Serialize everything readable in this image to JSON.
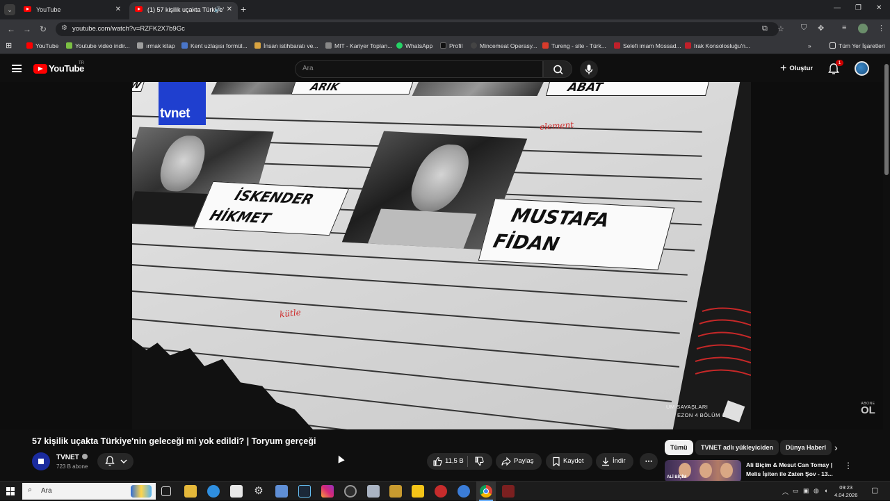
{
  "browser": {
    "tabs": [
      {
        "title": "YouTube",
        "active": false
      },
      {
        "title": "(1) 57 kişilik uçakta Türkiye'",
        "active": true
      }
    ],
    "url": "youtube.com/watch?v=RZFK2X7b9Gc",
    "bookmarks": [
      {
        "label": "YouTube",
        "color": "#ff0000"
      },
      {
        "label": "Youtube video indir...",
        "color": "#7bc043"
      },
      {
        "label": "ırmak kitap",
        "color": "#9e9e9e"
      },
      {
        "label": "Kent uzlaşısı formül...",
        "color": "#4a76c9"
      },
      {
        "label": "İnsan istihbaratı ve...",
        "color": "#d9a441"
      },
      {
        "label": "MIT - Kariyer Toplan...",
        "color": "#888888"
      },
      {
        "label": "WhatsApp",
        "color": "#25d366"
      },
      {
        "label": "Profil",
        "color": "#111111"
      },
      {
        "label": "Mincemeat Operasy...",
        "color": "#444444"
      },
      {
        "label": "Tureng - site - Türk...",
        "color": "#d83b2b"
      },
      {
        "label": "Selefi imam Mossad...",
        "color": "#c0202a"
      },
      {
        "label": "Irak Konsolosluğu'n...",
        "color": "#c0202a"
      }
    ],
    "all_bookmarks": "Tüm Yer İşaretleri"
  },
  "youtube": {
    "logo_text": "YouTube",
    "region": "TR",
    "search_placeholder": "Ara",
    "create_label": "Oluştur",
    "notification_count": "1"
  },
  "video_frame": {
    "brand": "tvnet",
    "names": [
      {
        "line1": "ARIK",
        "line2": ""
      },
      {
        "line1": "ABAT",
        "line2": ""
      },
      {
        "line1": "İSKENDER",
        "line2": "HİKMET"
      },
      {
        "line1": "MUSTAFA",
        "line2": "FİDAN"
      }
    ],
    "scribbles": [
      "element",
      "kütle"
    ],
    "caption_line1": "UM SAVAŞLARI",
    "caption_line2": "EZON 4 BÖLÜM 1",
    "corner_small": "ABONE",
    "corner_big": "OL",
    "partial_letter": "W"
  },
  "video": {
    "title": "57 kişilik uçakta Türkiye'nin geleceği mi yok edildi? | Toryum gerçeği",
    "channel": "TVNET",
    "subscribers": "723 B abone",
    "likes": "11,5 B",
    "share_label": "Paylaş",
    "save_label": "Kaydet",
    "download_label": "İndir"
  },
  "sidebar": {
    "chips": [
      "Tümü",
      "TVNET adlı yükleyiciden",
      "Dünya Haberl"
    ],
    "recommendation": {
      "title": "Ali Biçim & Mesut Can Tomay | Melis İşiten ile Zaten Şov - 13...",
      "thumb_text": "ALİ BİÇİM"
    }
  },
  "taskbar": {
    "search_label": "Ara",
    "time": "09:23",
    "date": "4.04.2026"
  }
}
